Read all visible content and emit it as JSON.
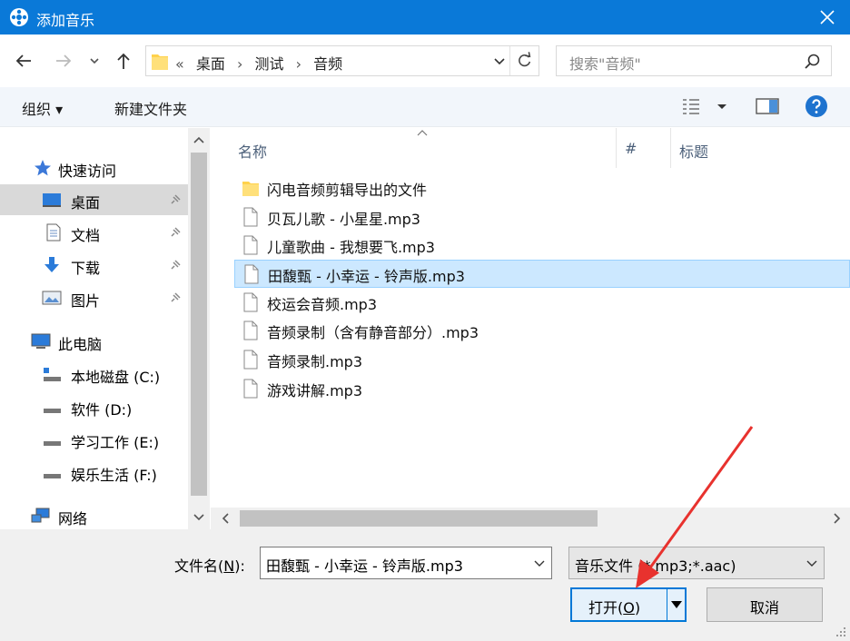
{
  "window": {
    "title": "添加音乐",
    "close_icon": "close-icon"
  },
  "nav": {
    "back_icon": "arrow-left-icon",
    "forward_icon": "arrow-right-icon",
    "recent_icon": "chevron-down-icon",
    "up_icon": "arrow-up-icon"
  },
  "address": {
    "overflow": "«",
    "crumbs": [
      "桌面",
      "测试",
      "音频"
    ],
    "separator": "›",
    "refresh_icon": "refresh-icon"
  },
  "search": {
    "placeholder": "搜索\"音频\""
  },
  "toolbar": {
    "organize": "组织 ▾",
    "new_folder": "新建文件夹"
  },
  "sidebar": {
    "quick_access": "快速访问",
    "items": [
      {
        "label": "桌面",
        "icon": "desktop-icon",
        "pinned": true,
        "selected": true
      },
      {
        "label": "文档",
        "icon": "document-icon",
        "pinned": true
      },
      {
        "label": "下载",
        "icon": "download-icon",
        "pinned": true
      },
      {
        "label": "图片",
        "icon": "pictures-icon",
        "pinned": true
      }
    ],
    "this_pc": "此电脑",
    "drives": [
      {
        "label": "本地磁盘 (C:)"
      },
      {
        "label": "软件 (D:)"
      },
      {
        "label": "学习工作 (E:)"
      },
      {
        "label": "娱乐生活 (F:)"
      }
    ],
    "network": "网络"
  },
  "columns": {
    "name": "名称",
    "number": "#",
    "title": "标题"
  },
  "files": [
    {
      "name": "闪电音频剪辑导出的文件",
      "type": "folder"
    },
    {
      "name": "贝瓦儿歌 - 小星星.mp3",
      "type": "file"
    },
    {
      "name": "儿童歌曲 - 我想要飞.mp3",
      "type": "file"
    },
    {
      "name": "田馥甄 - 小幸运 - 铃声版.mp3",
      "type": "file",
      "selected": true
    },
    {
      "name": "校运会音频.mp3",
      "type": "file"
    },
    {
      "name": "音频录制（含有静音部分）.mp3",
      "type": "file"
    },
    {
      "name": "音频录制.mp3",
      "type": "file"
    },
    {
      "name": "游戏讲解.mp3",
      "type": "file"
    }
  ],
  "footer": {
    "filename_label_pre": "文件名(",
    "filename_label_key": "N",
    "filename_label_post": "):",
    "filename_value": "田馥甄 - 小幸运 - 铃声版.mp3",
    "filetype_value": "音乐文件 (*.mp3;*.aac)",
    "open_pre": "打开(",
    "open_key": "O",
    "open_post": ")",
    "cancel": "取消"
  },
  "colors": {
    "titlebar": "#0a79d8",
    "selection": "#cce8ff",
    "annotation_arrow": "#e8322e"
  }
}
